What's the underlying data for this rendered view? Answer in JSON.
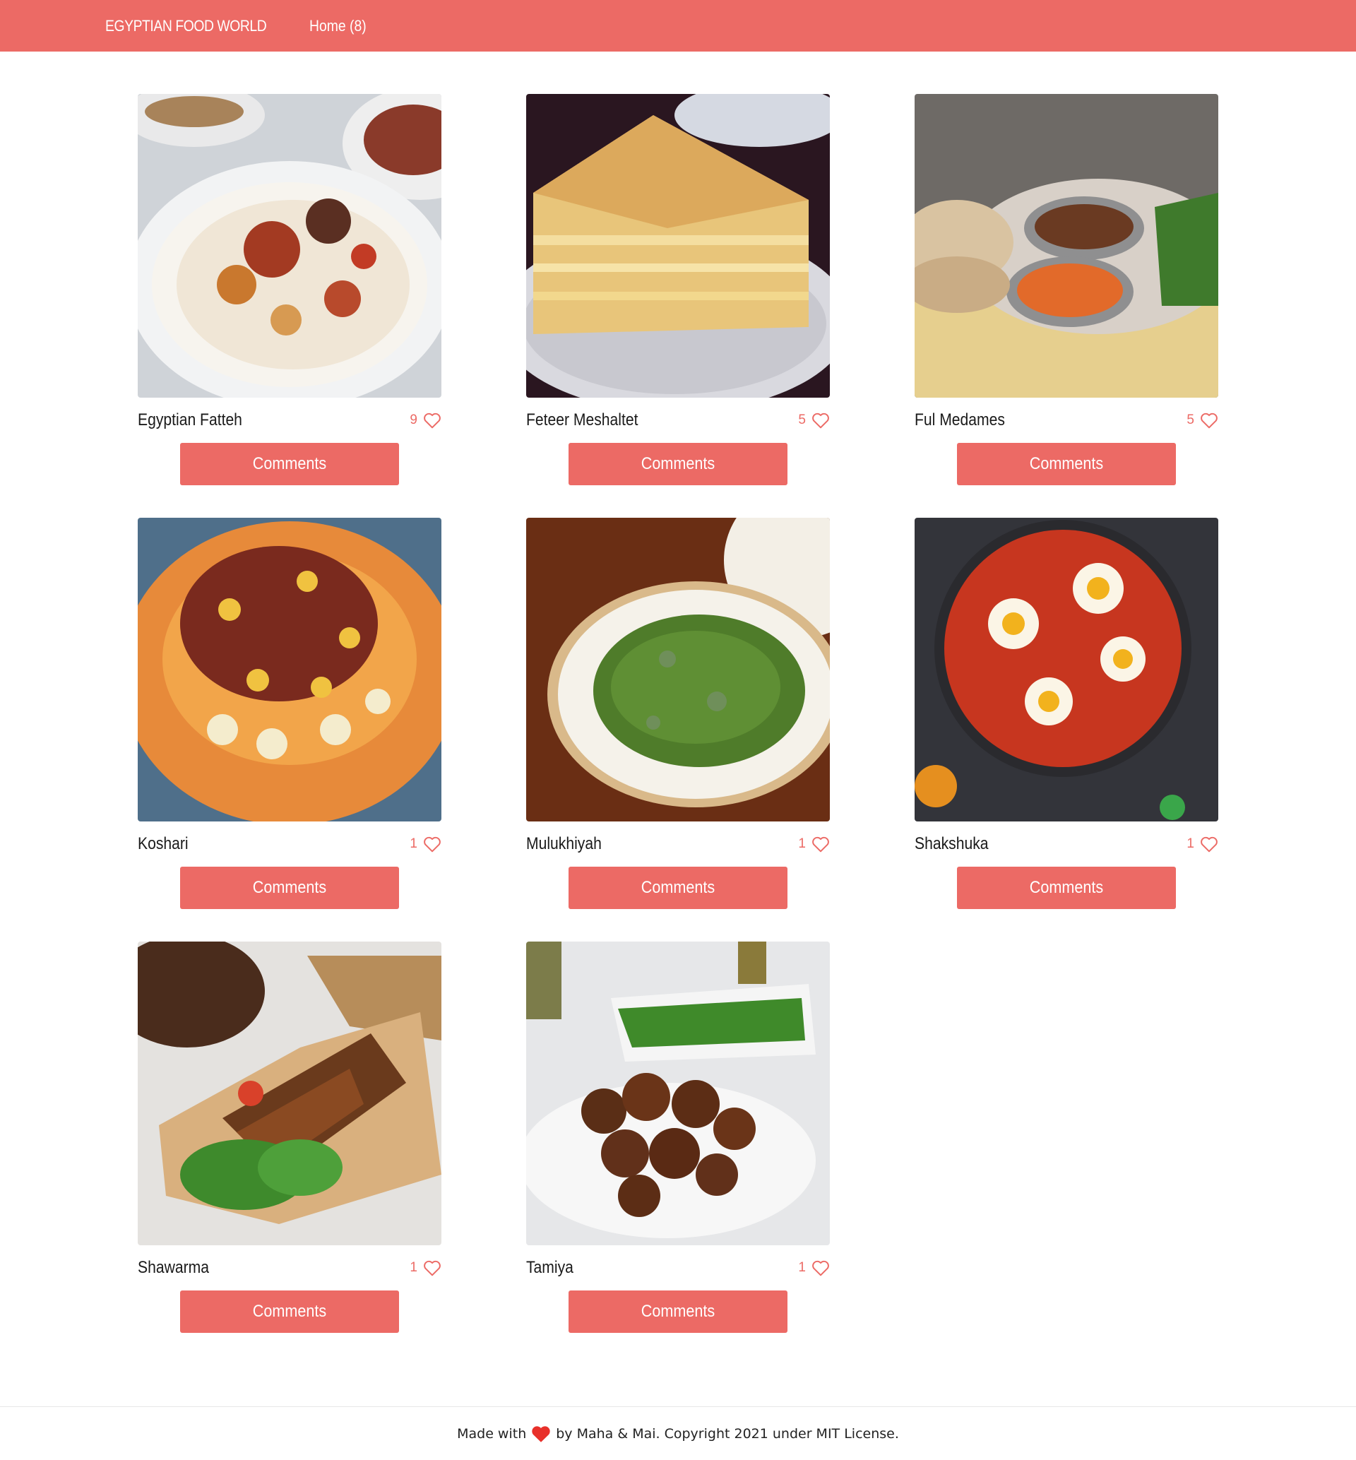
{
  "navbar": {
    "brand": "EGYPTIAN FOOD WORLD",
    "home_label": "Home (8)",
    "color": "#ec6a65"
  },
  "dishes": [
    {
      "name": "Egyptian Fatteh",
      "likes": "9",
      "button_label": "Comments"
    },
    {
      "name": "Feteer Meshaltet",
      "likes": "5",
      "button_label": "Comments"
    },
    {
      "name": "Ful Medames",
      "likes": "5",
      "button_label": "Comments"
    },
    {
      "name": "Koshari",
      "likes": "1",
      "button_label": "Comments"
    },
    {
      "name": "Mulukhiyah",
      "likes": "1",
      "button_label": "Comments"
    },
    {
      "name": "Shakshuka",
      "likes": "1",
      "button_label": "Comments"
    },
    {
      "name": "Shawarma",
      "likes": "1",
      "button_label": "Comments"
    },
    {
      "name": "Tamiya",
      "likes": "1",
      "button_label": "Comments"
    }
  ],
  "icons": {
    "like": "heart-outline-icon",
    "footer": "heart-solid-icon"
  },
  "footer": {
    "made_with": "Made with",
    "credit": "by Maha & Mai. Copyright 2021 under MIT License.",
    "heart_color": "#e8302a"
  }
}
